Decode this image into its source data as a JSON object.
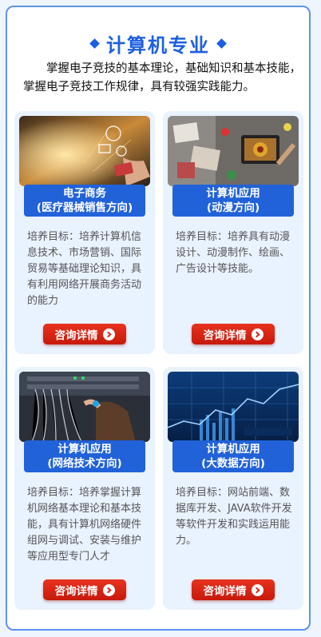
{
  "header": {
    "title": "计算机专业",
    "intro": "掌握电子竞技的基本理论，基础知识和基本技能，掌握电子竞技工作规律，具有较强实践能力。"
  },
  "cards": [
    {
      "label_line1": "电子商务",
      "label_line2": "(医疗器械销售方向)",
      "description": "培养目标：培养计算机信息技术、市场营销、国际贸易等基础理论知识，具有利用网络开展商务活动的能力",
      "button_label": "咨询详情"
    },
    {
      "label_line1": "计算机应用",
      "label_line2": "(动漫方向)",
      "description": "培养目标：培养具有动漫设计、动漫制作、绘画、广告设计等技能。",
      "button_label": "咨询详情"
    },
    {
      "label_line1": "计算机应用",
      "label_line2": "(网络技术方向)",
      "description": "培养目标：培养掌握计算机网络基本理论和基本技能，具有计算机网络硬件组网与调试、安装与维护等应用型专门人才",
      "button_label": "咨询详情"
    },
    {
      "label_line1": "计算机应用",
      "label_line2": "(大数据方向)",
      "description": "培养目标：网站前端、数据库开发、JAVA软件开发等软件开发和实践运用能力。",
      "button_label": "咨询详情"
    }
  ],
  "colors": {
    "accent_blue": "#1d5fe0",
    "button_red": "#d7261a",
    "card_bg": "#e9f2ff"
  }
}
